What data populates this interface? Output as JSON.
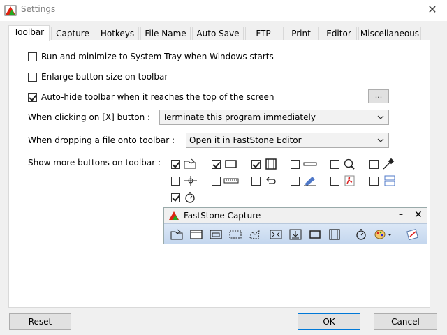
{
  "window": {
    "title": "Settings",
    "close": "✕"
  },
  "tabs": [
    "Toolbar",
    "Capture",
    "Hotkeys",
    "File Name",
    "Auto Save",
    "FTP",
    "Print",
    "Editor",
    "Miscellaneous"
  ],
  "options": {
    "tray": {
      "label": "Run and minimize to System Tray when Windows starts",
      "checked": false
    },
    "enlarge": {
      "label": "Enlarge button size on toolbar",
      "checked": false
    },
    "autohide": {
      "label": "Auto-hide toolbar when it reaches the top of the screen",
      "checked": true
    },
    "more_button": "..."
  },
  "close_action": {
    "label": "When clicking on [X] button :",
    "value": "Terminate this program immediately"
  },
  "drop_action": {
    "label": "When dropping a file onto toolbar :",
    "value": "Open it in FastStone Editor"
  },
  "more_buttons": {
    "label": "Show more buttons on toolbar :",
    "items": [
      {
        "icon": "open-folder-icon",
        "checked": true
      },
      {
        "icon": "region-capture-icon",
        "checked": true
      },
      {
        "icon": "video-capture-icon",
        "checked": true
      },
      {
        "icon": "minimize-bar-icon",
        "checked": false
      },
      {
        "icon": "magnifier-icon",
        "checked": false
      },
      {
        "icon": "color-picker-icon",
        "checked": false
      },
      {
        "icon": "crosshair-icon",
        "checked": false
      },
      {
        "icon": "ruler-icon",
        "checked": false
      },
      {
        "icon": "undo-arrow-icon",
        "checked": false
      },
      {
        "icon": "blue-pen-icon",
        "checked": false
      },
      {
        "icon": "pdf-icon",
        "checked": false
      },
      {
        "icon": "compare-icon",
        "checked": false
      },
      {
        "icon": "timer-icon",
        "checked": true
      }
    ]
  },
  "preview_toolbar": {
    "title": "FastStone Capture",
    "minimize": "–",
    "close": "✕"
  },
  "buttons": {
    "reset": "Reset",
    "ok": "OK",
    "cancel": "Cancel"
  }
}
